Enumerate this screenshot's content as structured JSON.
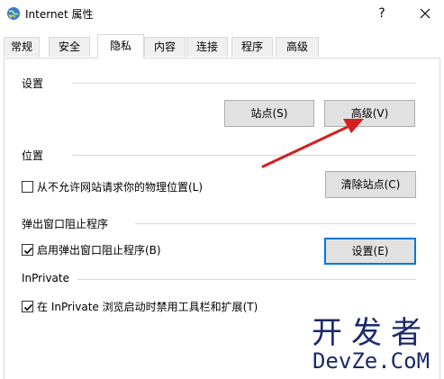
{
  "window": {
    "title": "Internet 属性",
    "help_label": "?",
    "close_icon": "close-icon"
  },
  "tabs": [
    {
      "label": "常规",
      "active": false
    },
    {
      "label": "安全",
      "active": false
    },
    {
      "label": "隐私",
      "active": true
    },
    {
      "label": "内容",
      "active": false
    },
    {
      "label": "连接",
      "active": false
    },
    {
      "label": "程序",
      "active": false
    },
    {
      "label": "高级",
      "active": false
    }
  ],
  "settings_section": {
    "label": "设置",
    "sites_button": "站点(S)",
    "advanced_button": "高级(V)"
  },
  "location_section": {
    "label": "位置",
    "checkbox_label": "从不允许网站请求你的物理位置(L)",
    "checkbox_checked": false,
    "clear_sites_button": "清除站点(C)"
  },
  "popup_section": {
    "label": "弹出窗口阻止程序",
    "checkbox_label": "启用弹出窗口阻止程序(B)",
    "checkbox_checked": true,
    "settings_button": "设置(E)"
  },
  "inprivate_section": {
    "label": "InPrivate",
    "checkbox_label": "在 InPrivate 浏览启动时禁用工具栏和扩展(T)",
    "checkbox_checked": true
  },
  "annotation": {
    "arrow_color": "#d42020"
  },
  "watermark": {
    "line1": "开发者",
    "line2": "DevZe.CoM"
  }
}
